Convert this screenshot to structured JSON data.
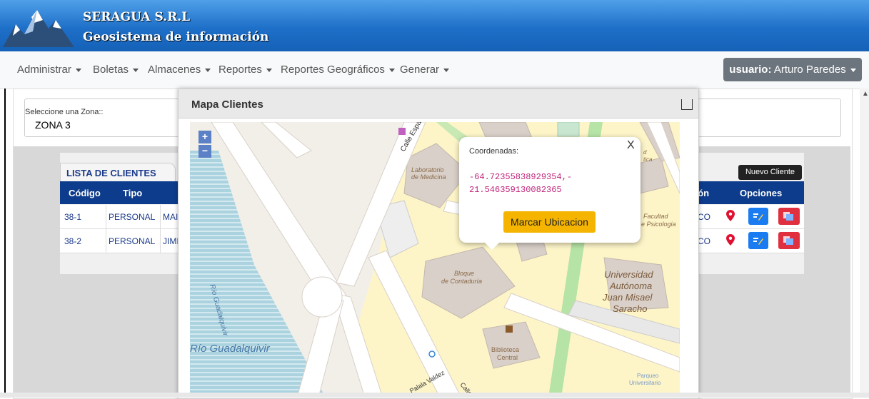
{
  "header": {
    "company": "SERAGUA S.R.L",
    "subtitle": "Geosistema de información"
  },
  "nav": {
    "items": [
      {
        "label": "Administrar"
      },
      {
        "label": "Boletas"
      },
      {
        "label": "Almacenes"
      },
      {
        "label": "Reportes"
      },
      {
        "label": "Reportes Geográficos"
      },
      {
        "label": "Generar"
      }
    ],
    "user_prefix": "usuario:",
    "user_name": "Arturo Paredes"
  },
  "zone": {
    "label": "Seleccione una Zona::",
    "value": "ZONA 3"
  },
  "clients": {
    "tab": "LISTA DE CLIENTES",
    "new_button": "Nuevo Cliente",
    "columns": [
      "Código",
      "Tipo",
      "llón",
      "Opciones"
    ],
    "rows": [
      {
        "codigo": "38-1",
        "tipo": "PERSONAL",
        "nombre": "MAI",
        "extra": "CO"
      },
      {
        "codigo": "38-2",
        "tipo": "PERSONAL",
        "nombre": "JIMI",
        "extra": "CO"
      }
    ]
  },
  "modal": {
    "title": "Mapa Clientes",
    "zoom_in": "+",
    "zoom_out": "−"
  },
  "map": {
    "labels": {
      "calle_espana": "Calle España",
      "lab_medicina_1": "Laboratorio",
      "lab_medicina_2": "de Medicina",
      "facultad_1": "Facultad",
      "facultad_2": "e Psicologia",
      "bloque_1": "Bloque",
      "bloque_2": "de Contaduría",
      "universidad_1": "Universidad",
      "universidad_2": "Autónoma",
      "universidad_3": "Juan Misael",
      "universidad_4": "Saracho",
      "rio_vertical": "Río Guadalquivir",
      "rio_horizontal": "Río Guadalquivir",
      "biblioteca_1": "Biblioteca",
      "biblioteca_2": "Central",
      "palala": "Palala Valdez",
      "parqueo_1": "Parqueo",
      "parqueo_2": "Universitario",
      "calle2": "Calle",
      "tica": "tica",
      "d": "d"
    }
  },
  "popup": {
    "label": "Coordenadas:",
    "coord_line1": "-64.72355838929354,-",
    "coord_line2": "21.546359130082365",
    "button": "Marcar Ubicacion",
    "close": "X"
  },
  "colors": {
    "header_blue": "#1e6fc8",
    "table_header": "#0d3c8c",
    "popup_button": "#f5b400",
    "coord_text": "#c0257a"
  }
}
